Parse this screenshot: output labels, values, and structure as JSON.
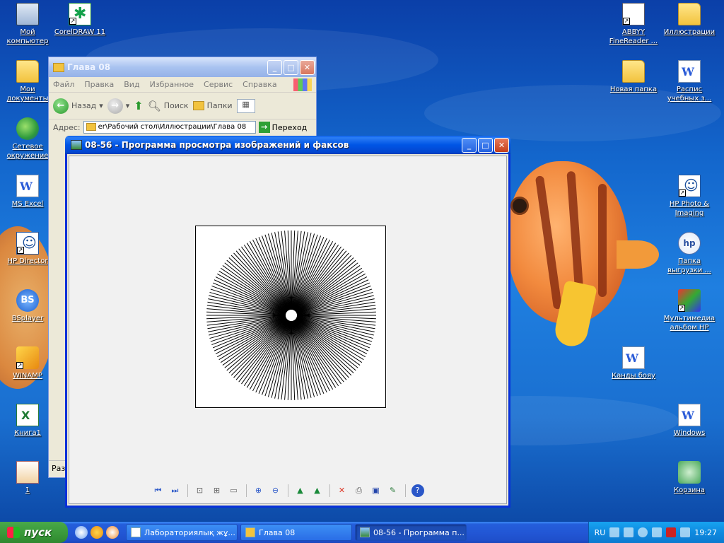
{
  "desktop_icons": {
    "my_computer": "Мой компьютер",
    "coreldraw": "CorelDRAW 11",
    "my_documents": "Мои документы",
    "network": "Сетевое окружение",
    "ms_excel": "MS Excel",
    "hp_director": "HP Director",
    "bsplayer": "BSplayer",
    "winamp": "WINAMP",
    "kniga1": "Книга1",
    "one": "1",
    "abbyy": "ABBYY FineReader ...",
    "illustrations": "Иллюстрации",
    "new_folder": "Новая папка",
    "schedule": "Распис учебных з...",
    "hp_photo": "HP Photo & Imaging",
    "upload_folder": "Папка выгрузки ...",
    "multimedia": "Мультимедиа альбом HP",
    "kandy": "Канды бояу",
    "windows": "Windows",
    "recycle": "Корзина"
  },
  "explorer": {
    "title": "Глава 08",
    "menu": [
      "Файл",
      "Правка",
      "Вид",
      "Избранное",
      "Сервис",
      "Справка"
    ],
    "back_label": "Назад",
    "search_label": "Поиск",
    "folders_label": "Папки",
    "address_label": "Адрес:",
    "address_value": "er\\Рабочий стол\\Иллюстрации\\Глава 08",
    "go_label": "Переход",
    "status_text": "Разм"
  },
  "viewer": {
    "title": "08-56 - Программа просмотра изображений и факсов",
    "image": {
      "rays": 160,
      "description_colors": {
        "rays": "#000000",
        "background": "#ffffff"
      }
    }
  },
  "taskbar": {
    "start_label": "пуск",
    "tasks": [
      "Лабораториялық жұ...",
      "Глава 08",
      "08-56 - Программа п..."
    ],
    "lang": "RU",
    "clock": "19:27"
  },
  "colors": {
    "title_active": "#0055e5",
    "desktop_blue": "#1f7fe0",
    "taskbar": "#2257d5",
    "start_green": "#3b9b3b"
  }
}
